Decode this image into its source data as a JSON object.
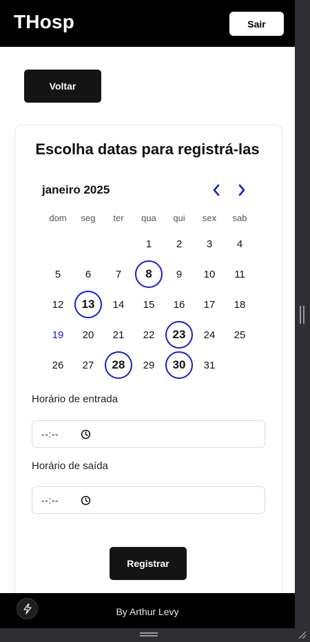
{
  "header": {
    "brand": "THosp",
    "logout_label": "Sair"
  },
  "back_label": "Voltar",
  "card": {
    "title": "Escolha datas para registrá-las",
    "calendar": {
      "month_label": "janeiro 2025",
      "weekdays": [
        "dom",
        "seg",
        "ter",
        "qua",
        "qui",
        "sex",
        "sab"
      ],
      "first_weekday_index": 3,
      "days_in_month": 31,
      "selected_days": [
        8,
        13,
        23,
        28,
        30
      ],
      "today": 19,
      "days": [
        "1",
        "2",
        "3",
        "4",
        "5",
        "6",
        "7",
        "8",
        "9",
        "10",
        "11",
        "12",
        "13",
        "14",
        "15",
        "16",
        "17",
        "18",
        "19",
        "20",
        "21",
        "22",
        "23",
        "24",
        "25",
        "26",
        "27",
        "28",
        "29",
        "30",
        "31"
      ]
    },
    "entry": {
      "label": "Horário de entrada",
      "value": "--:--"
    },
    "exit": {
      "label": "Horário de saída",
      "value": "--:--"
    },
    "submit_label": "Registrar"
  },
  "footer": {
    "text": "By Arthur Levy"
  },
  "colors": {
    "accent": "#1a1ad6",
    "header_bg": "#000000",
    "button_bg": "#141414"
  },
  "icons": {
    "prev": "chevron-left-icon",
    "next": "chevron-right-icon",
    "time": "clock-icon",
    "footer_action": "bolt-icon"
  }
}
